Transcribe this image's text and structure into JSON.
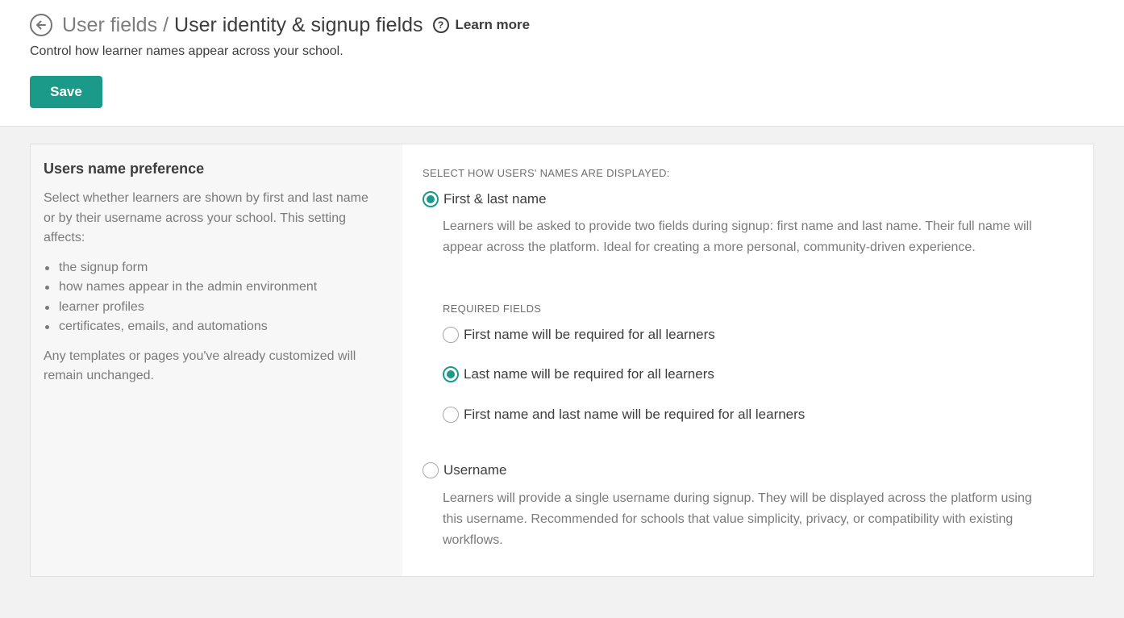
{
  "header": {
    "breadcrumb_parent": "User fields",
    "breadcrumb_separator": "/",
    "title": "User identity & signup fields",
    "learn_more_label": "Learn more",
    "subtitle": "Control how learner names appear across your school.",
    "save_label": "Save"
  },
  "left_panel": {
    "title": "Users name preference",
    "description": "Select whether learners are shown by first and last name or by their username across your school. This setting affects:",
    "items": [
      "the signup form",
      "how names appear in the admin environment",
      "learner profiles",
      "certificates, emails, and automations"
    ],
    "note": "Any templates or pages you've already customized will remain unchanged."
  },
  "right_panel": {
    "section_label": "SELECT HOW USERS' NAMES ARE DISPLAYED:",
    "options": [
      {
        "label": "First & last name",
        "checked": true,
        "description": "Learners will be asked to provide two fields during signup: first name and last name. Their full name will appear across the platform. Ideal for creating a more personal, community-driven experience."
      },
      {
        "label": "Username",
        "checked": false,
        "description": "Learners will provide a single username during signup. They will be displayed across the platform using this username. Recommended for schools that value simplicity, privacy, or compatibility with existing workflows."
      }
    ],
    "required_fields_label": "REQUIRED FIELDS",
    "required_options": [
      {
        "label": "First name will be required for all learners",
        "checked": false
      },
      {
        "label": "Last name will be required for all learners",
        "checked": true
      },
      {
        "label": "First name and last name will be required for all learners",
        "checked": false
      }
    ]
  },
  "colors": {
    "accent": "#1b9a8a",
    "background": "#f2f2f2",
    "text": "#3d3d3d",
    "muted_text": "#7a7a7a"
  },
  "icons": {
    "back": "arrow-left-circle-icon",
    "help": "question-circle-icon"
  }
}
